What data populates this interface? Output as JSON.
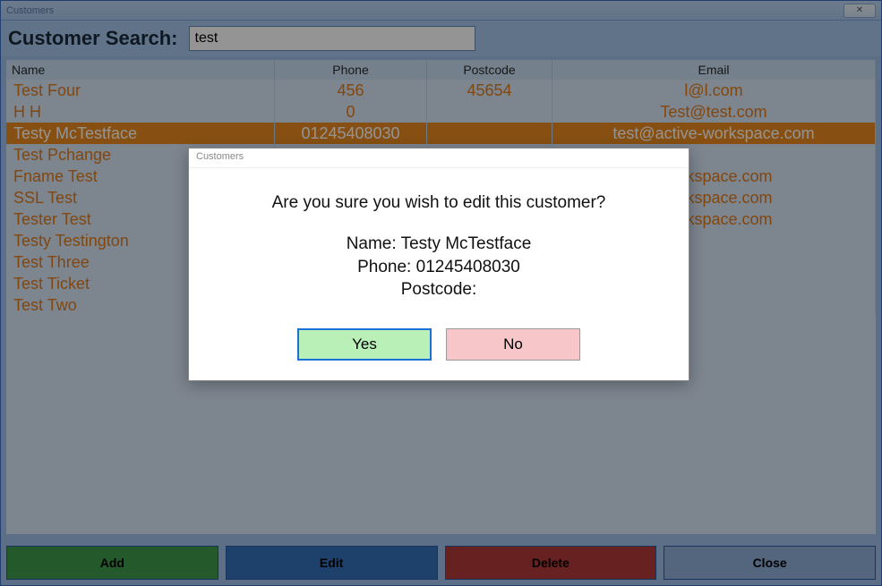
{
  "window": {
    "title": "Customers",
    "close_glyph": "✕"
  },
  "search": {
    "label": "Customer Search:",
    "value": "test"
  },
  "columns": {
    "name": "Name",
    "phone": "Phone",
    "postcode": "Postcode",
    "email": "Email"
  },
  "rows": [
    {
      "name": "Test Four",
      "phone": "456",
      "postcode": "45654",
      "email": "l@l.com",
      "selected": false
    },
    {
      "name": "H H",
      "phone": "0",
      "postcode": "",
      "email": "Test@test.com",
      "selected": false
    },
    {
      "name": "Testy McTestface",
      "phone": "01245408030",
      "postcode": "",
      "email": "test@active-workspace.com",
      "selected": true
    },
    {
      "name": "Test Pchange",
      "phone": "",
      "postcode": "",
      "email": "",
      "selected": false
    },
    {
      "name": "Fname Test",
      "phone": "",
      "postcode": "",
      "email": "-workspace.com",
      "selected": false
    },
    {
      "name": "SSL Test",
      "phone": "",
      "postcode": "",
      "email": "-workspace.com",
      "selected": false
    },
    {
      "name": "Tester Test",
      "phone": "",
      "postcode": "",
      "email": "-workspace.com",
      "selected": false
    },
    {
      "name": "Testy Testington",
      "phone": "",
      "postcode": "",
      "email": "",
      "selected": false
    },
    {
      "name": "Test Three",
      "phone": "",
      "postcode": "",
      "email": "",
      "selected": false
    },
    {
      "name": "Test Ticket",
      "phone": "",
      "postcode": "",
      "email": "",
      "selected": false
    },
    {
      "name": "Test Two",
      "phone": "",
      "postcode": "",
      "email": "",
      "selected": false
    }
  ],
  "buttons": {
    "add": "Add",
    "edit": "Edit",
    "delete": "Delete",
    "close": "Close"
  },
  "modal": {
    "title": "Customers",
    "message": "Are you sure you wish to edit this customer?",
    "name_label": "Name:",
    "name_value": "Testy McTestface",
    "phone_label": "Phone:",
    "phone_value": "01245408030",
    "postcode_label": "Postcode:",
    "postcode_value": "",
    "yes": "Yes",
    "no": "No"
  }
}
